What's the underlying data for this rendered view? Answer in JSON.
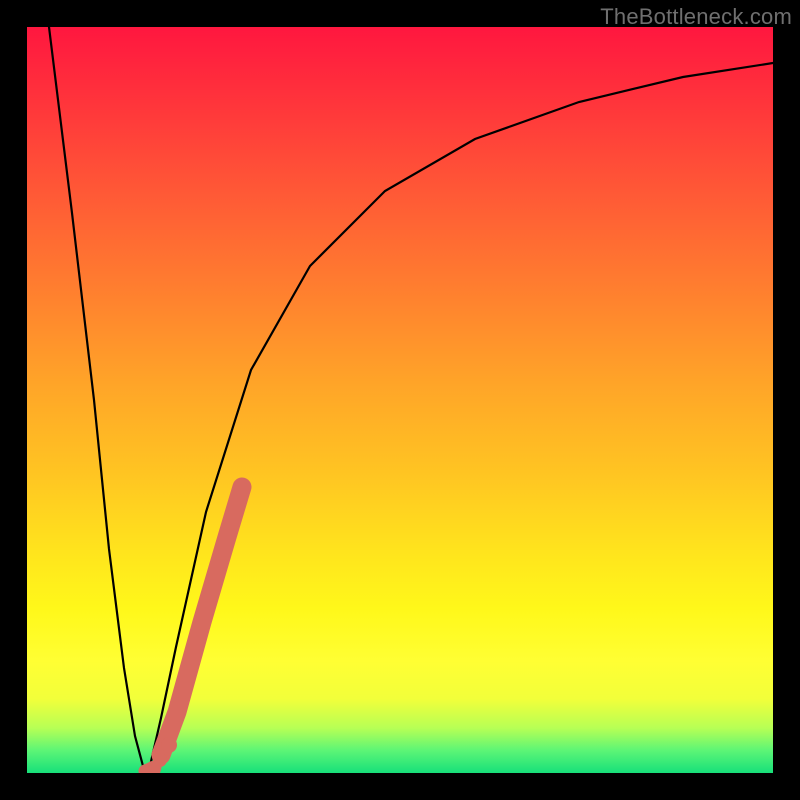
{
  "watermark": "TheBottleneck.com",
  "chart_data": {
    "type": "line",
    "title": "",
    "xlabel": "",
    "ylabel": "",
    "xlim": [
      0,
      100
    ],
    "ylim": [
      0,
      100
    ],
    "series": [
      {
        "name": "bottleneck-curve",
        "x": [
          3,
          6,
          9,
          11,
          13,
          14.5,
          15.5,
          16,
          16.5,
          18,
          20,
          24,
          30,
          38,
          48,
          60,
          74,
          88,
          100
        ],
        "values": [
          100,
          75,
          50,
          30,
          14,
          5,
          1,
          0,
          1,
          7,
          17,
          35,
          54,
          68,
          78,
          85,
          90,
          93,
          95
        ]
      }
    ],
    "marker_segment": {
      "name": "highlight-range",
      "color": "#d86a5f",
      "x_start": 17,
      "x_end": 29,
      "y_start": 2,
      "y_end": 50
    },
    "optimum": {
      "x": 16,
      "y": 0
    }
  },
  "colors": {
    "frame": "#000000",
    "curve": "#000000",
    "marker": "#d86a5f",
    "watermark": "#6f6f6f"
  }
}
